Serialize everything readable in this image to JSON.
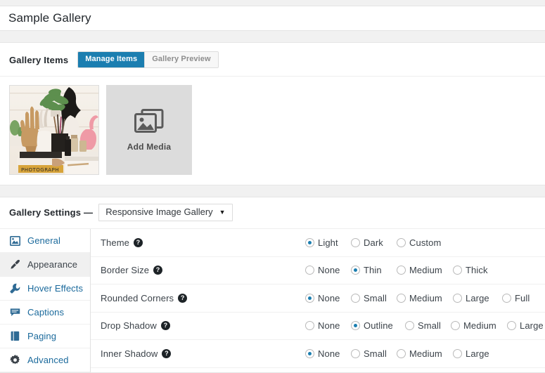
{
  "page": {
    "title": "Sample Gallery"
  },
  "gallery_items": {
    "label": "Gallery Items",
    "tabs": [
      {
        "label": "Manage Items",
        "active": true
      },
      {
        "label": "Gallery Preview",
        "active": false
      }
    ],
    "thumbnail": {
      "alt": "artist desk with paintbrushes, plants, hand sculpture, books and flamingo"
    },
    "add_media": {
      "label": "Add Media",
      "icon": "stacked-images-icon"
    }
  },
  "gallery_settings": {
    "label": "Gallery Settings —",
    "gallery_select": {
      "value": "Responsive Image Gallery",
      "caret": "▼"
    },
    "sidebar": [
      {
        "label": "General",
        "icon": "image-icon",
        "active": false
      },
      {
        "label": "Appearance",
        "icon": "brush-icon",
        "active": true
      },
      {
        "label": "Hover Effects",
        "icon": "wrench-icon",
        "active": false
      },
      {
        "label": "Captions",
        "icon": "comment-icon",
        "active": false
      },
      {
        "label": "Paging",
        "icon": "book-icon",
        "active": false
      },
      {
        "label": "Advanced",
        "icon": "gear-icon",
        "active": false
      }
    ],
    "help_glyph": "?",
    "rows": [
      {
        "label": "Theme",
        "options": [
          {
            "label": "Light",
            "checked": true
          },
          {
            "label": "Dark",
            "checked": false
          },
          {
            "label": "Custom",
            "checked": false
          }
        ]
      },
      {
        "label": "Border Size",
        "options": [
          {
            "label": "None",
            "checked": false
          },
          {
            "label": "Thin",
            "checked": true
          },
          {
            "label": "Medium",
            "checked": false
          },
          {
            "label": "Thick",
            "checked": false
          }
        ]
      },
      {
        "label": "Rounded Corners",
        "options": [
          {
            "label": "None",
            "checked": true
          },
          {
            "label": "Small",
            "checked": false
          },
          {
            "label": "Medium",
            "checked": false
          },
          {
            "label": "Large",
            "checked": false
          },
          {
            "label": "Full",
            "checked": false
          }
        ]
      },
      {
        "label": "Drop Shadow",
        "options": [
          {
            "label": "None",
            "checked": false
          },
          {
            "label": "Outline",
            "checked": true
          },
          {
            "label": "Small",
            "checked": false
          },
          {
            "label": "Medium",
            "checked": false
          },
          {
            "label": "Large",
            "checked": false
          }
        ]
      },
      {
        "label": "Inner Shadow",
        "options": [
          {
            "label": "None",
            "checked": true
          },
          {
            "label": "Small",
            "checked": false
          },
          {
            "label": "Medium",
            "checked": false
          },
          {
            "label": "Large",
            "checked": false
          }
        ]
      }
    ]
  },
  "colors": {
    "accent": "#1b7eb0",
    "link": "#1b6a9c",
    "page_bg": "#f1f1f1",
    "panel_bg": "#ffffff"
  }
}
